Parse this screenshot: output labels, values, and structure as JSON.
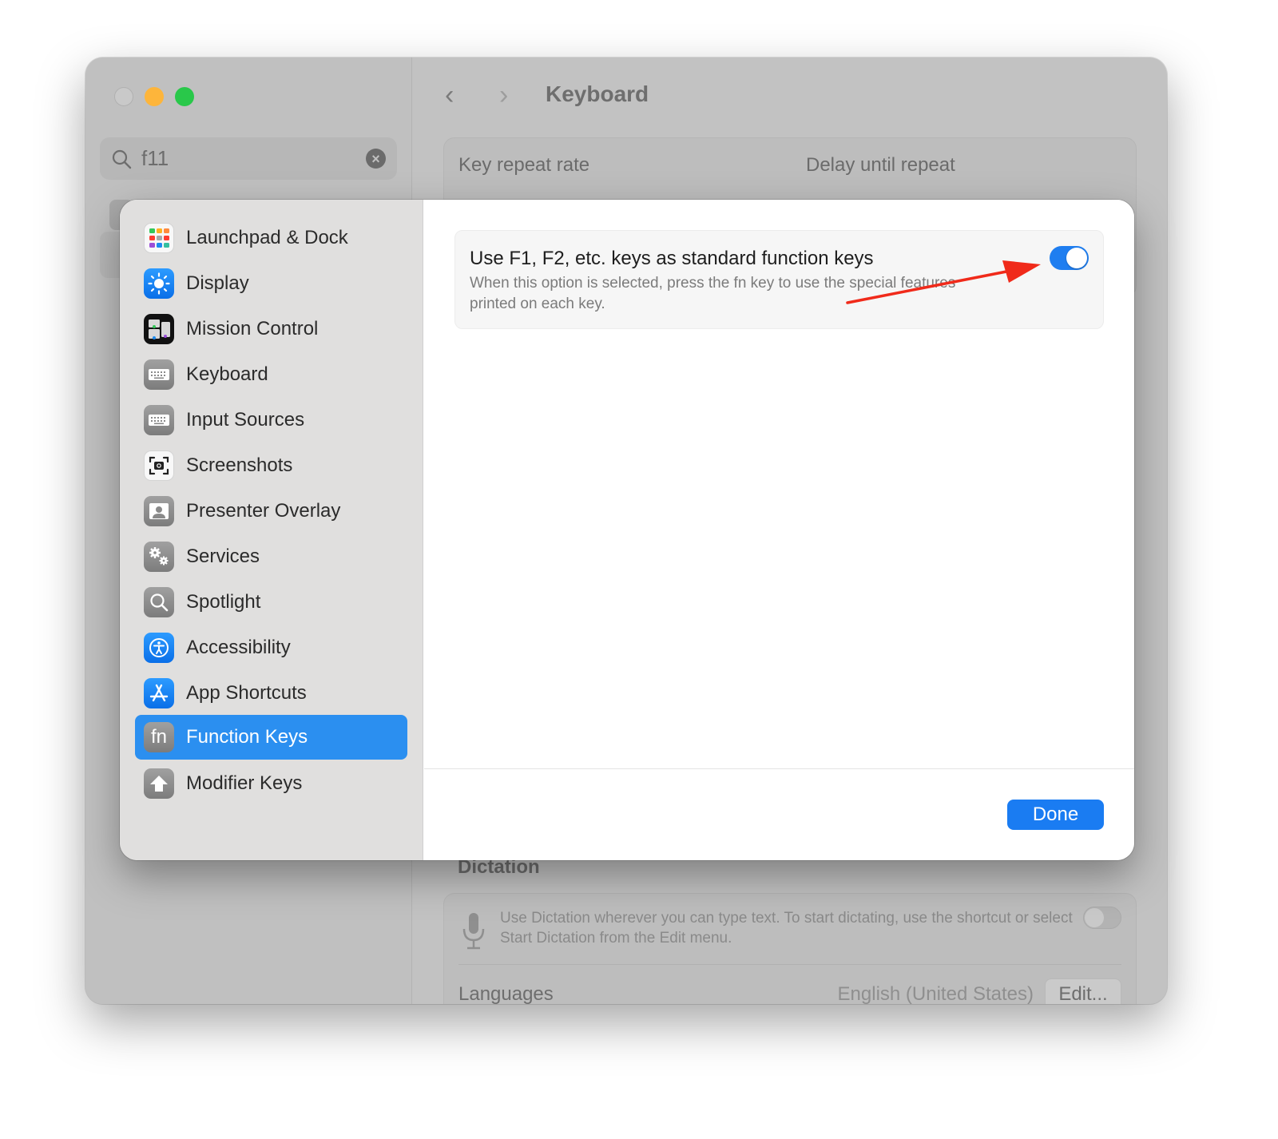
{
  "window": {
    "title": "Keyboard",
    "search": {
      "value": "f11",
      "icon": "search-icon",
      "clear_icon": "clear-icon"
    },
    "nav": {
      "back_icon": "chevron-left-icon",
      "forward_icon": "chevron-right-icon"
    },
    "background_content": {
      "key_repeat_rate_label": "Key repeat rate",
      "delay_until_repeat_label": "Delay until repeat",
      "dictation_heading": "Dictation",
      "dictation_description": "Use Dictation wherever you can type text. To start dictating, use the shortcut or select Start Dictation from the Edit menu.",
      "dictation_enabled": false,
      "languages_label": "Languages",
      "languages_value": "English (United States)",
      "edit_button": "Edit..."
    }
  },
  "sheet": {
    "sidebar": {
      "items": [
        {
          "label": "Launchpad & Dock",
          "icon": "launchpad-icon",
          "selected": false
        },
        {
          "label": "Display",
          "icon": "display-brightness-icon",
          "selected": false
        },
        {
          "label": "Mission Control",
          "icon": "mission-control-icon",
          "selected": false
        },
        {
          "label": "Keyboard",
          "icon": "keyboard-icon",
          "selected": false
        },
        {
          "label": "Input Sources",
          "icon": "keyboard-icon",
          "selected": false
        },
        {
          "label": "Screenshots",
          "icon": "camera-icon",
          "selected": false
        },
        {
          "label": "Presenter Overlay",
          "icon": "person-icon",
          "selected": false
        },
        {
          "label": "Services",
          "icon": "gears-icon",
          "selected": false
        },
        {
          "label": "Spotlight",
          "icon": "magnifier-icon",
          "selected": false
        },
        {
          "label": "Accessibility",
          "icon": "accessibility-icon",
          "selected": false
        },
        {
          "label": "App Shortcuts",
          "icon": "app-store-icon",
          "selected": false
        },
        {
          "label": "Function Keys",
          "icon": "fn-icon",
          "selected": true
        },
        {
          "label": "Modifier Keys",
          "icon": "shift-arrow-icon",
          "selected": false
        }
      ],
      "fn_glyph": "fn"
    },
    "option": {
      "title": "Use F1, F2, etc. keys as standard function keys",
      "description": "When this option is selected, press the fn key to use the special features printed on each key.",
      "enabled": true
    },
    "done_button": "Done"
  },
  "colors": {
    "accent": "#1a7cf2",
    "selection": "#2b8ff0",
    "annotation_arrow": "#f02a1a",
    "traffic_min": "#fdb53b",
    "traffic_max": "#29c84a"
  }
}
